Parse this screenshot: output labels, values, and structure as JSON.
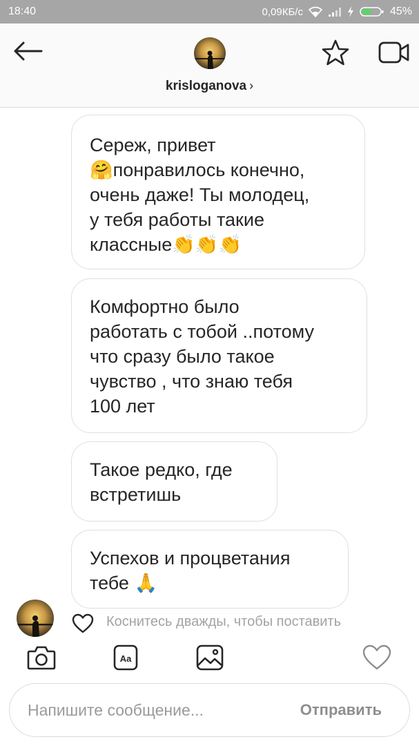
{
  "status_bar": {
    "time": "18:40",
    "network_speed": "0,09КБ/с",
    "battery": "45%"
  },
  "header": {
    "username": "krisloganova",
    "chevron": "›",
    "icons": [
      "back-arrow-icon",
      "star-icon",
      "video-camera-icon"
    ]
  },
  "messages": [
    {
      "lines": [
        "Сереж, привет",
        "🤗понравилось конечно,",
        "очень даже! Ты молодец,",
        "у тебя работы такие",
        "классные👏👏👏"
      ]
    },
    {
      "lines": [
        "Комфортно было",
        "работать с тобой ..потому",
        "что сразу было такое",
        "чувство , что знаю тебя",
        "100 лет"
      ]
    },
    {
      "lines": [
        "Такое редко, где",
        "встретишь"
      ]
    },
    {
      "lines": [
        "Успехов и процветания",
        "тебе 🙏"
      ]
    }
  ],
  "like_hint": "Коснитесь дважды, чтобы поставить",
  "toolbar": {
    "icons": [
      "camera-icon",
      "text-style-icon",
      "gallery-icon",
      "heart-icon"
    ],
    "text_icon_label": "Aa"
  },
  "composer": {
    "placeholder": "Напишите сообщение...",
    "send_label": "Отправить"
  },
  "colors": {
    "status_bar_bg": "#a6a6a6",
    "header_bg": "#fafafa",
    "bubble_border": "#dfdfdf",
    "hint_text": "#a3a3a3",
    "send_text": "#8e8e8e"
  }
}
